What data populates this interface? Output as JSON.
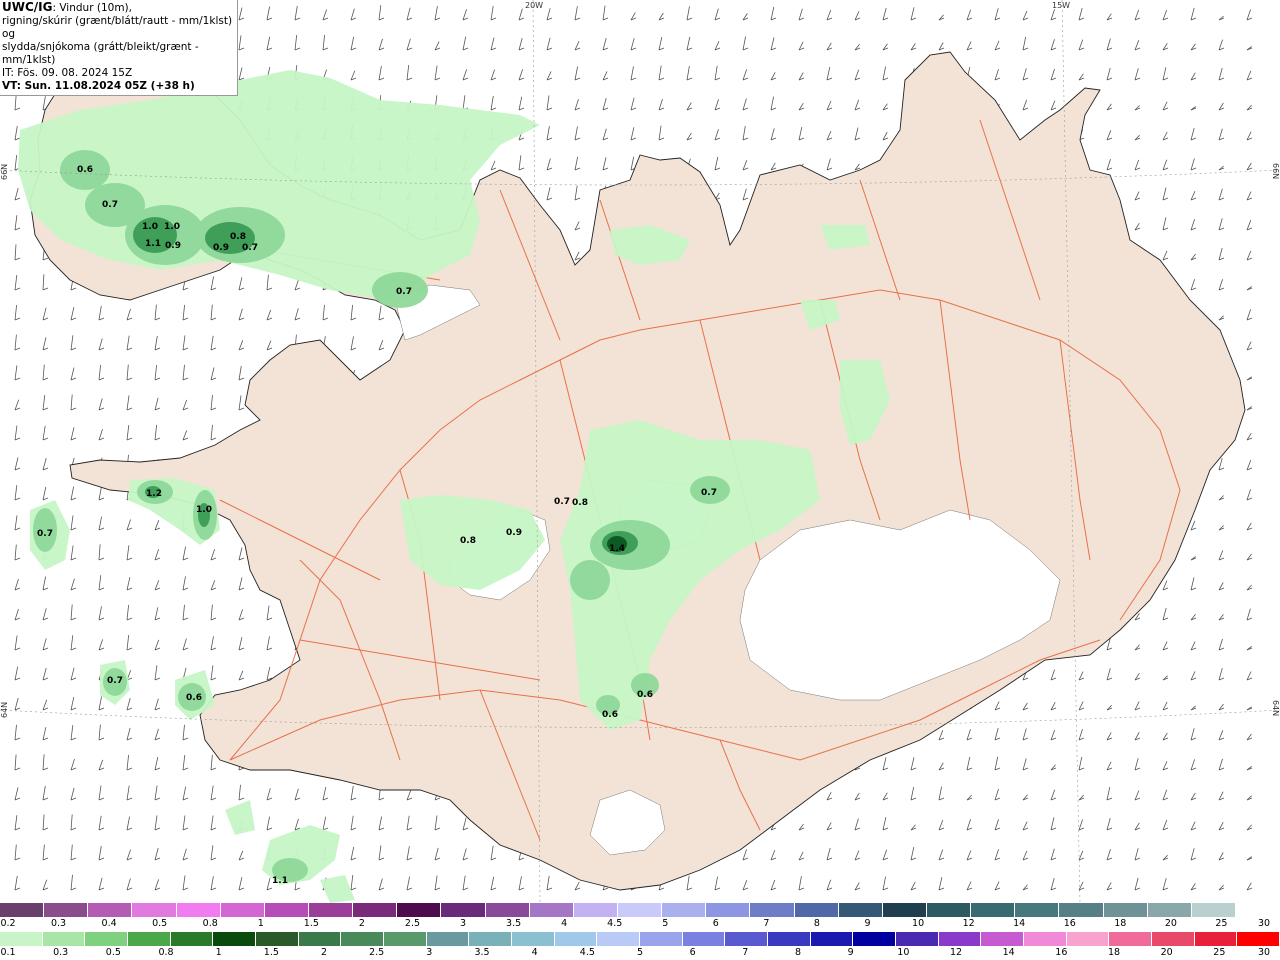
{
  "header": {
    "model": "UWC/IG",
    "line1": ": Vindur (10m),",
    "line2": "rigning/skúrir (grænt/blátt/rautt - mm/1klst) og",
    "line3": "slydda/snjókoma (grátt/bleikt/grænt - mm/1klst)",
    "it": "IT: Fös. 09. 08. 2024 15Z",
    "vt": "VT: Sun. 11.08.2024 05Z (+38 h)"
  },
  "graticule": {
    "lon_20w": "20W",
    "lon_15w": "15W",
    "lat_66n_left": "66N",
    "lat_66n_right": "66N",
    "lat_64n_left": "64N",
    "lat_64n_right": "64N"
  },
  "colors": {
    "land": "#f2e3d6",
    "glacier": "#ffffff",
    "roads": "#e8643c",
    "coast": "#222222",
    "precip_light": "#c6f5c6",
    "precip_mid": "#8fd89a",
    "precip_dark": "#3f9e58",
    "precip_darkest": "#0e5a24"
  },
  "precip_values": [
    {
      "id": "v1",
      "text": "0.6"
    },
    {
      "id": "v2",
      "text": "0.7"
    },
    {
      "id": "v3",
      "text": "1.0"
    },
    {
      "id": "v4",
      "text": "1.0"
    },
    {
      "id": "v5",
      "text": "1.1"
    },
    {
      "id": "v6",
      "text": "0.9"
    },
    {
      "id": "v7",
      "text": "0.8"
    },
    {
      "id": "v8",
      "text": "0.9"
    },
    {
      "id": "v9",
      "text": "0.7"
    },
    {
      "id": "v10",
      "text": "0.7"
    },
    {
      "id": "v11",
      "text": "1.2"
    },
    {
      "id": "v12",
      "text": "1.0"
    },
    {
      "id": "v13",
      "text": "0.7"
    },
    {
      "id": "v14",
      "text": "0.7"
    },
    {
      "id": "v15",
      "text": "0.8"
    },
    {
      "id": "v16",
      "text": "0.7"
    },
    {
      "id": "v17",
      "text": "0.9"
    },
    {
      "id": "v18",
      "text": "0.8"
    },
    {
      "id": "v19",
      "text": "1.4"
    },
    {
      "id": "v20",
      "text": "0.7"
    },
    {
      "id": "v21",
      "text": "0.6"
    },
    {
      "id": "v22",
      "text": "0.6"
    },
    {
      "id": "v23",
      "text": "0.6"
    },
    {
      "id": "v24",
      "text": "1.1"
    }
  ],
  "legend_snow": {
    "colors": [
      "#6b3f6b",
      "#8a4c8a",
      "#b45cb4",
      "#e07ae0",
      "#f07cf0",
      "#d366d3",
      "#b64db6",
      "#9a3e9a",
      "#7a2a7a",
      "#4d0a4d",
      "#6a2a7a",
      "#8a4a9a",
      "#a676c6",
      "#c2b2f2",
      "#c9cafa",
      "#aab0ee",
      "#8c96e2",
      "#6f7dc7",
      "#5168a6",
      "#355876",
      "#1f3f4f",
      "#2d5a62",
      "#386a72",
      "#46787e",
      "#567f86",
      "#6e9296",
      "#8aa8aa",
      "#bad0cf",
      "#ffffff"
    ],
    "labels": [
      "0.2",
      "0.3",
      "0.4",
      "0.5",
      "0.8",
      "1",
      "1.5",
      "2",
      "2.5",
      "3",
      "3.5",
      "4",
      "4.5",
      "5",
      "6",
      "7",
      "8",
      "9",
      "10",
      "12",
      "14",
      "16",
      "18",
      "20",
      "25",
      "30"
    ]
  },
  "legend_rain": {
    "colors": [
      "#c8f4c8",
      "#a8e6a8",
      "#7fd07f",
      "#4aa84a",
      "#2a7a2a",
      "#0a4a0a",
      "#2a5a2a",
      "#3a7a4a",
      "#4a8a5a",
      "#5a9a6a",
      "#6a9aa0",
      "#7ab0b8",
      "#8ac0d0",
      "#a0c8e8",
      "#bacaf6",
      "#9aa4ec",
      "#7a80e0",
      "#5a5ad0",
      "#3a3ac0",
      "#1a1ab0",
      "#0000a0",
      "#4a2ab0",
      "#8a3ac8",
      "#c65ad0",
      "#f08ad8",
      "#f8a2d0",
      "#f06a9a",
      "#e84a6a",
      "#e8203a",
      "#ff0000"
    ],
    "labels": [
      "0.1",
      "0.3",
      "0.5",
      "0.8",
      "1",
      "1.5",
      "2",
      "2.5",
      "3",
      "3.5",
      "4",
      "4.5",
      "5",
      "6",
      "7",
      "8",
      "9",
      "10",
      "12",
      "14",
      "16",
      "18",
      "20",
      "25",
      "30"
    ]
  }
}
